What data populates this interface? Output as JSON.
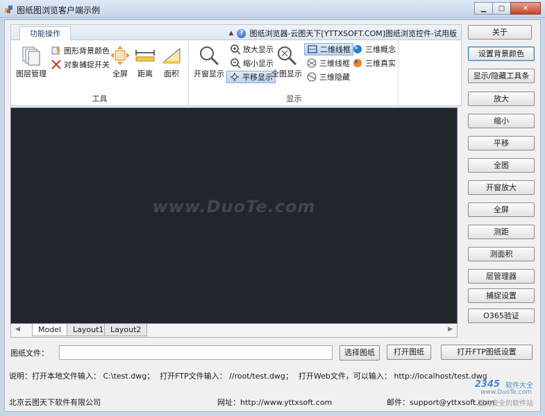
{
  "window": {
    "title": "图纸图浏览客户端示例",
    "minimize": "▁",
    "maximize": "□",
    "close": "✕"
  },
  "ribbon": {
    "tab": "功能操作",
    "info": "图纸浏览器-云图天下[YTTXSOFT.COM]图纸浏览控件-试用版",
    "groups": {
      "tools": {
        "label": "工具",
        "layer_manage": "图层管理",
        "bg_color": "图形背景颜色",
        "snap_toggle": "对象捕捉开关",
        "fullscreen": "全屏",
        "distance": "距离",
        "area": "面积"
      },
      "display": {
        "label": "显示",
        "window_zoom": "开窗显示",
        "zoom_in": "放大显示",
        "zoom_out": "缩小显示",
        "pan": "平移显示",
        "zoom_all": "全图显示",
        "wire2d": "二维线框",
        "wire3d": "三维线框",
        "hidden3d": "三维隐藏",
        "concept3d": "三维概念",
        "real3d": "三维真实"
      }
    }
  },
  "canvas": {
    "watermark": "www.DuoTe.com"
  },
  "layout_tabs": [
    "Model",
    "Layout1",
    "Layout2"
  ],
  "side_buttons": [
    "关于",
    "设置背景颜色",
    "显示/隐藏工具条",
    "放大",
    "缩小",
    "平移",
    "全图",
    "开窗放大",
    "全屏",
    "测距",
    "测面积",
    "层管理器",
    "捕捉设置",
    "O365验证"
  ],
  "file": {
    "label": "图纸文件：",
    "value": "",
    "select_button": "选择图纸",
    "open_button": "打开图纸",
    "ftp_button": "打开FTP图纸设置"
  },
  "description": {
    "prefix": "说明：",
    "local": "打开本地文件输入：  C:\\test.dwg；",
    "ftp": "打开FTP文件输入：  //root/test.dwg；",
    "web": "打开Web文件，可以输入：  http://localhost/test.dwg"
  },
  "footer": {
    "company": "北京云图天下软件有限公司",
    "website_label": "网址：",
    "website": "http://www.yttxsoft.com",
    "email_label": "邮件：",
    "email": "support@yttxsoft.com"
  },
  "overlay_logo": {
    "num": "2345",
    "name": "软件大全",
    "url": "www.DuoTe.com",
    "sub": "国内安全的软件站"
  }
}
